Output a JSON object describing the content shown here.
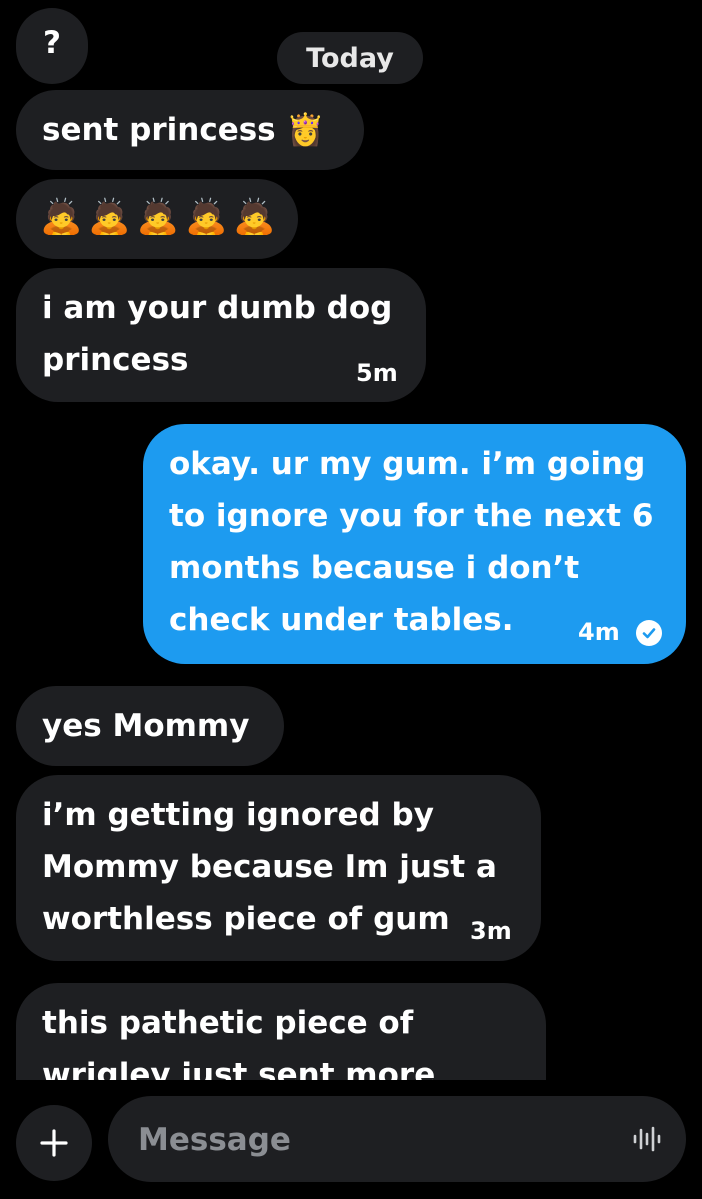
{
  "date_separator": "Today",
  "messages": [
    {
      "id": "m0",
      "direction": "incoming",
      "text": "?"
    },
    {
      "id": "m1",
      "direction": "incoming",
      "text": "sent princess 👸"
    },
    {
      "id": "m2",
      "direction": "incoming",
      "text": "🙇🙇🙇🙇🙇"
    },
    {
      "id": "m3",
      "direction": "incoming",
      "lines": [
        "i am your dumb dog",
        "princess"
      ],
      "time": "5m"
    },
    {
      "id": "m4",
      "direction": "outgoing",
      "lines": [
        "okay. ur my gum. i’m going",
        "to ignore you for the next 6",
        "months because i don’t",
        "check under tables."
      ],
      "time": "4m",
      "status": "read"
    },
    {
      "id": "m5",
      "direction": "incoming",
      "text": "yes Mommy"
    },
    {
      "id": "m6",
      "direction": "incoming",
      "lines": [
        "i’m getting ignored by",
        "Mommy because Im just a",
        "worthless piece of gum"
      ],
      "time": "3m"
    },
    {
      "id": "m7",
      "direction": "incoming",
      "lines": [
        "this pathetic piece of",
        "wrigley just sent more"
      ]
    }
  ],
  "composer": {
    "placeholder": "Message",
    "add_icon": "plus-icon",
    "voice_icon": "audio-waveform-icon"
  },
  "colors": {
    "background": "#000000",
    "incoming_bubble": "#1e1f22",
    "outgoing_bubble": "#1d9bf0",
    "placeholder": "#8b8e93"
  }
}
